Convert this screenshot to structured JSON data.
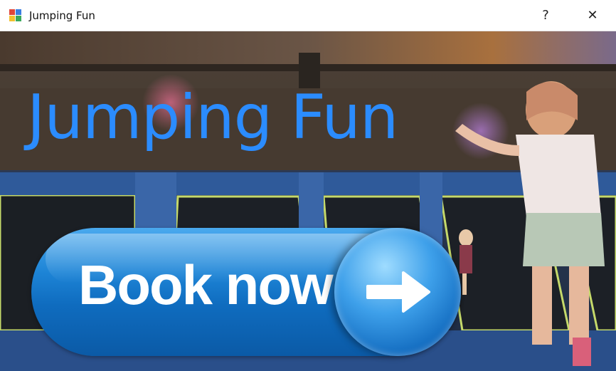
{
  "window": {
    "title": "Jumping Fun",
    "help_label": "?",
    "close_label": "✕"
  },
  "main": {
    "headline": "Jumping Fun",
    "book_button_label": "Book now"
  },
  "icons": {
    "app": "app-icon",
    "arrow": "arrow-right-icon"
  },
  "colors": {
    "headline": "#2b8cff",
    "button_blue": "#1d84d6"
  }
}
